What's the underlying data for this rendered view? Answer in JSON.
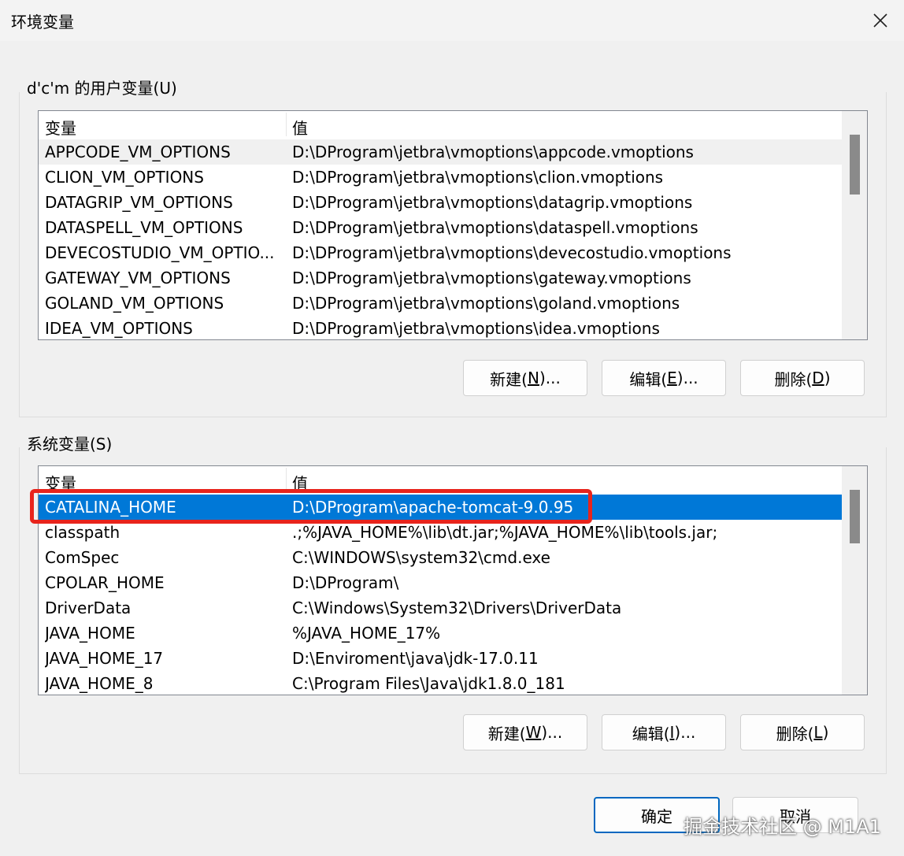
{
  "window": {
    "title": "环境变量"
  },
  "user_vars": {
    "group_label": "d'c'm 的用户变量(U)",
    "columns": [
      "变量",
      "值"
    ],
    "rows": [
      {
        "name": "APPCODE_VM_OPTIONS",
        "value": "D:\\DProgram\\jetbra\\vmoptions\\appcode.vmoptions"
      },
      {
        "name": "CLION_VM_OPTIONS",
        "value": "D:\\DProgram\\jetbra\\vmoptions\\clion.vmoptions"
      },
      {
        "name": "DATAGRIP_VM_OPTIONS",
        "value": "D:\\DProgram\\jetbra\\vmoptions\\datagrip.vmoptions"
      },
      {
        "name": "DATASPELL_VM_OPTIONS",
        "value": "D:\\DProgram\\jetbra\\vmoptions\\dataspell.vmoptions"
      },
      {
        "name": "DEVECOSTUDIO_VM_OPTIO...",
        "value": "D:\\DProgram\\jetbra\\vmoptions\\devecostudio.vmoptions"
      },
      {
        "name": "GATEWAY_VM_OPTIONS",
        "value": "D:\\DProgram\\jetbra\\vmoptions\\gateway.vmoptions"
      },
      {
        "name": "GOLAND_VM_OPTIONS",
        "value": "D:\\DProgram\\jetbra\\vmoptions\\goland.vmoptions"
      },
      {
        "name": "IDEA_VM_OPTIONS",
        "value": "D:\\DProgram\\jetbra\\vmoptions\\idea.vmoptions"
      }
    ],
    "buttons": {
      "new": {
        "pre": "新建(",
        "key": "N",
        "post": ")..."
      },
      "edit": {
        "pre": "编辑(",
        "key": "E",
        "post": ")..."
      },
      "delete": {
        "pre": "删除(",
        "key": "D",
        "post": ")"
      }
    }
  },
  "system_vars": {
    "group_label": "系统变量(S)",
    "columns": [
      "变量",
      "值"
    ],
    "rows": [
      {
        "name": "CATALINA_HOME",
        "value": "D:\\DProgram\\apache-tomcat-9.0.95"
      },
      {
        "name": "classpath",
        "value": ".;%JAVA_HOME%\\lib\\dt.jar;%JAVA_HOME%\\lib\\tools.jar;"
      },
      {
        "name": "ComSpec",
        "value": "C:\\WINDOWS\\system32\\cmd.exe"
      },
      {
        "name": "CPOLAR_HOME",
        "value": "D:\\DProgram\\"
      },
      {
        "name": "DriverData",
        "value": "C:\\Windows\\System32\\Drivers\\DriverData"
      },
      {
        "name": "JAVA_HOME",
        "value": "%JAVA_HOME_17%"
      },
      {
        "name": "JAVA_HOME_17",
        "value": "D:\\Enviroment\\java\\jdk-17.0.11"
      },
      {
        "name": "JAVA_HOME_8",
        "value": "C:\\Program Files\\Java\\jdk1.8.0_181"
      }
    ],
    "buttons": {
      "new": {
        "pre": "新建(",
        "key": "W",
        "post": ")..."
      },
      "edit": {
        "pre": "编辑(",
        "key": "I",
        "post": ")..."
      },
      "delete": {
        "pre": "删除(",
        "key": "L",
        "post": ")"
      }
    }
  },
  "footer": {
    "ok_label": "确定",
    "cancel_label": "取消"
  },
  "watermark": "掘金技术社区 @ M1A1",
  "colors": {
    "selection": "#0078d7",
    "highlight_border": "#e8241c",
    "ok_border": "#0067c0"
  }
}
